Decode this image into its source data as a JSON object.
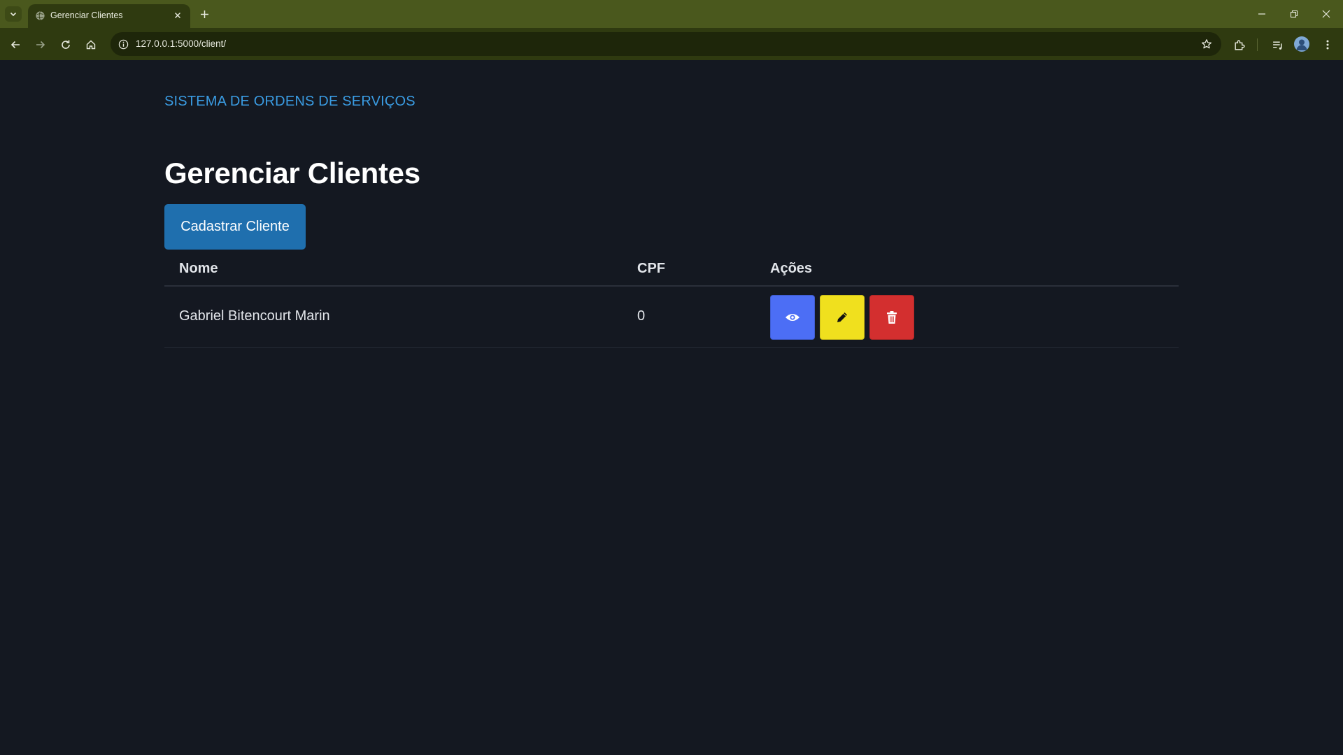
{
  "browser": {
    "tab_title": "Gerenciar Clientes",
    "url": "127.0.0.1:5000/client/"
  },
  "header": {
    "brand": "SISTEMA DE ORDENS DE SERVIÇOS"
  },
  "main": {
    "title": "Gerenciar Clientes",
    "add_button_label": "Cadastrar Cliente",
    "table": {
      "columns": [
        "Nome",
        "CPF",
        "Ações"
      ],
      "rows": [
        {
          "nome": "Gabriel Bitencourt Marin",
          "cpf": "0"
        }
      ]
    },
    "actions": [
      {
        "icon": "eye-icon",
        "color": "#4c6ef5"
      },
      {
        "icon": "pencil-icon",
        "color": "#f0e01e"
      },
      {
        "icon": "trash-icon",
        "color": "#d32f2f"
      }
    ]
  },
  "colors": {
    "tabstrip": "#4a581d",
    "toolbar": "#2f3a10",
    "page_bg": "#141821",
    "brand_link": "#3a9be2",
    "primary_button": "#1f6fae"
  }
}
